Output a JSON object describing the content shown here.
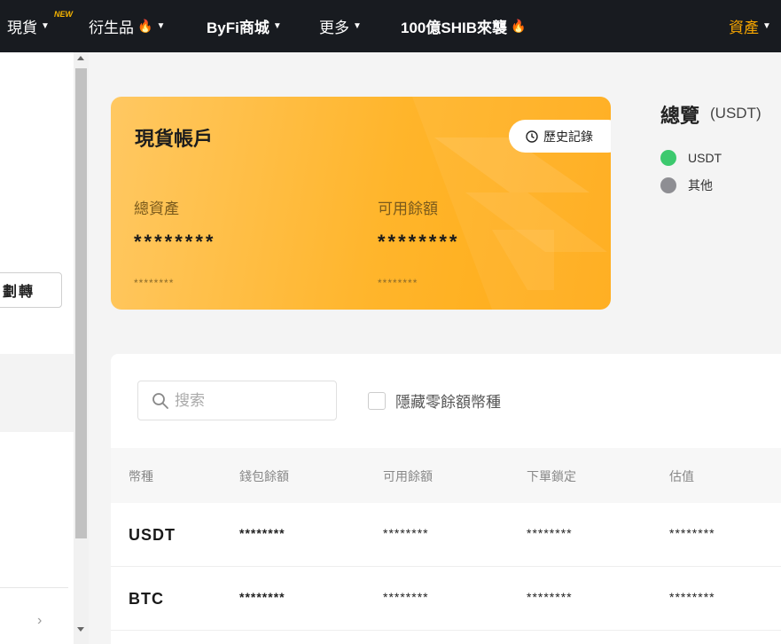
{
  "nav": {
    "spot": "現貨",
    "new_badge": "NEW",
    "derivatives": "衍生品",
    "byfi_mall": "ByFi商城",
    "more": "更多",
    "shib_promo": "100億SHIB來襲",
    "assets": "資產"
  },
  "sidebar": {
    "transfer_label": "劃轉"
  },
  "spot_card": {
    "title": "現貨帳戶",
    "history_label": "歷史記錄",
    "total_assets_label": "總資產",
    "total_assets_value": "********",
    "total_assets_sub": "********",
    "available_label": "可用餘額",
    "available_value": "********",
    "available_sub": "********"
  },
  "overview": {
    "title": "總覽",
    "unit": "(USDT)",
    "legend": [
      {
        "label": "USDT",
        "color": "#3cc96e"
      },
      {
        "label": "其他",
        "color": "#8e8e93"
      }
    ]
  },
  "assets_panel": {
    "search_placeholder": "搜索",
    "hide_zero_label": "隱藏零餘額幣種",
    "columns": [
      "幣種",
      "錢包餘額",
      "可用餘額",
      "下單鎖定",
      "估值"
    ],
    "rows": [
      {
        "coin": "USDT",
        "wallet": "********",
        "available": "********",
        "locked": "********",
        "value": "********"
      },
      {
        "coin": "BTC",
        "wallet": "********",
        "available": "********",
        "locked": "********",
        "value": "********"
      }
    ]
  }
}
